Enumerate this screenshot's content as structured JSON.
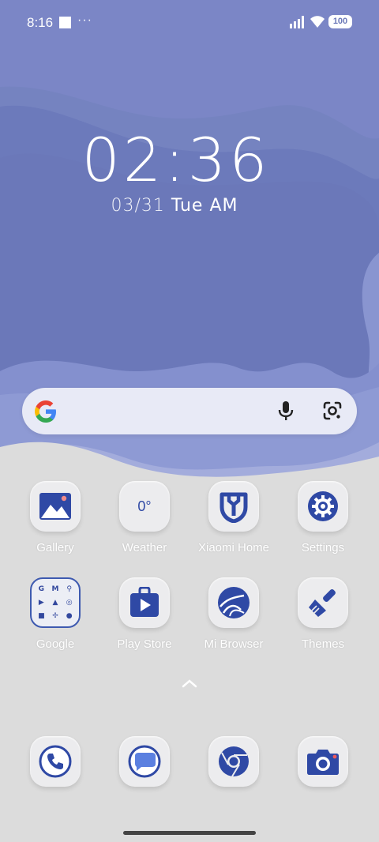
{
  "status_bar": {
    "time": "8:16",
    "notification_dots": "···",
    "battery": "100"
  },
  "lock": {
    "time": "02:36",
    "date": "03/31",
    "weekday": "Tue",
    "ampm": "AM"
  },
  "search_bar": {
    "left_icon": "google-g-icon",
    "mic_icon": "mic-icon",
    "lens_icon": "google-lens-icon"
  },
  "apps_row1": [
    {
      "label": "Gallery",
      "icon": "gallery-icon"
    },
    {
      "label": "Weather",
      "icon": "weather-icon",
      "value": "0°"
    },
    {
      "label": "Xiaomi Home",
      "icon": "xiaomi-home-icon"
    },
    {
      "label": "Settings",
      "icon": "settings-gear-icon"
    }
  ],
  "apps_row2": [
    {
      "label": "Google",
      "icon": "google-folder-icon",
      "folder_glyphs": [
        "G",
        "M",
        "⚲",
        "▶",
        "▲",
        "◎",
        "■",
        "✢",
        "●"
      ]
    },
    {
      "label": "Play Store",
      "icon": "play-store-icon"
    },
    {
      "label": "Mi Browser",
      "icon": "mi-browser-icon"
    },
    {
      "label": "Themes",
      "icon": "themes-brush-icon"
    }
  ],
  "dock": [
    {
      "icon": "phone-icon"
    },
    {
      "icon": "messages-icon"
    },
    {
      "icon": "chrome-icon"
    },
    {
      "icon": "camera-icon"
    }
  ],
  "colors": {
    "wallpaper_blue": "#7b87c6",
    "icon_blue": "#33489e",
    "bottom_gray": "#dcdcdc"
  }
}
